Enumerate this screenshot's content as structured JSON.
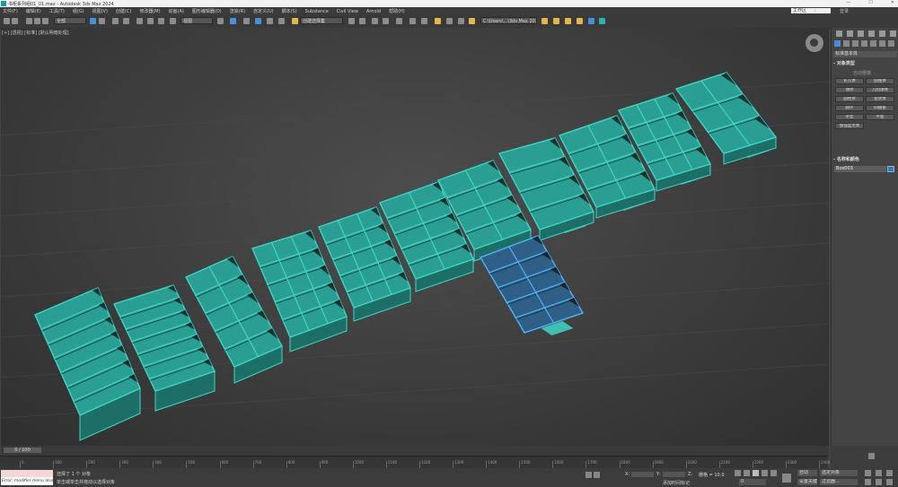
{
  "app": {
    "title": "书柜系列组01_01.max - Autodesk 3ds Max 2024",
    "window_buttons": [
      "—",
      "☐",
      "✕"
    ]
  },
  "menubar": {
    "items": [
      "文件(F)",
      "编辑(E)",
      "工具(T)",
      "组(G)",
      "视图(V)",
      "创建(C)",
      "修改器(M)",
      "动画(A)",
      "图形编辑器(D)",
      "渲染(R)",
      "自定义(U)",
      "脚本(S)",
      "Substance",
      "Civil View",
      "Arnold",
      "帮助(H)"
    ],
    "workspace_label": "工作区",
    "workspace_value": "默认",
    "user": "登录"
  },
  "toolbar": {
    "selection_filter": "全部",
    "reference_coord": "视图",
    "named_selection": "创建选择集",
    "project_path": "C:\\Users\\...\\3ds Max 2024"
  },
  "viewport": {
    "label": "[+] [透视] [标准] [默认明暗处理]",
    "accent_color": "#3fd6c5",
    "selected_color": "#4fb3ff"
  },
  "command_panel": {
    "category": "标准基本体",
    "rollout_object_type": "- 对象类型",
    "autogrid": "自动栅格",
    "buttons": [
      "长方体",
      "圆锥体",
      "球体",
      "几何球体",
      "圆柱体",
      "管状体",
      "圆环",
      "四棱锥",
      "茶壶",
      "平面",
      "加强型文本"
    ],
    "rollout_name_color": "- 名称和颜色",
    "object_name": "Box003",
    "object_color": "#1e7fd3"
  },
  "timeline": {
    "slider_text": "0 / 100",
    "ticks": [
      "0",
      "100",
      "200",
      "300",
      "400",
      "500",
      "600",
      "700",
      "800",
      "900",
      "1000",
      "1100",
      "1200",
      "1300",
      "1400",
      "1500",
      "1600",
      "1700",
      "1800",
      "1900",
      "2000",
      "2100",
      "2200",
      "2300",
      "2400"
    ]
  },
  "statusbar": {
    "maxscript_error": "Error: modifier menu also",
    "selection_info": "选择了 1 个 对象",
    "prompt": "单击或单击并拖动以选择对象",
    "x_label": "X:",
    "y_label": "Y:",
    "z_label": "Z:",
    "grid": "栅格 = 10.0",
    "add_time_tag": "添加时间标记",
    "auto_key": "自动",
    "set_key": "设置关键点",
    "selected_set": "选定对象",
    "key_filters": "过滤器...",
    "frame_value": "0"
  }
}
